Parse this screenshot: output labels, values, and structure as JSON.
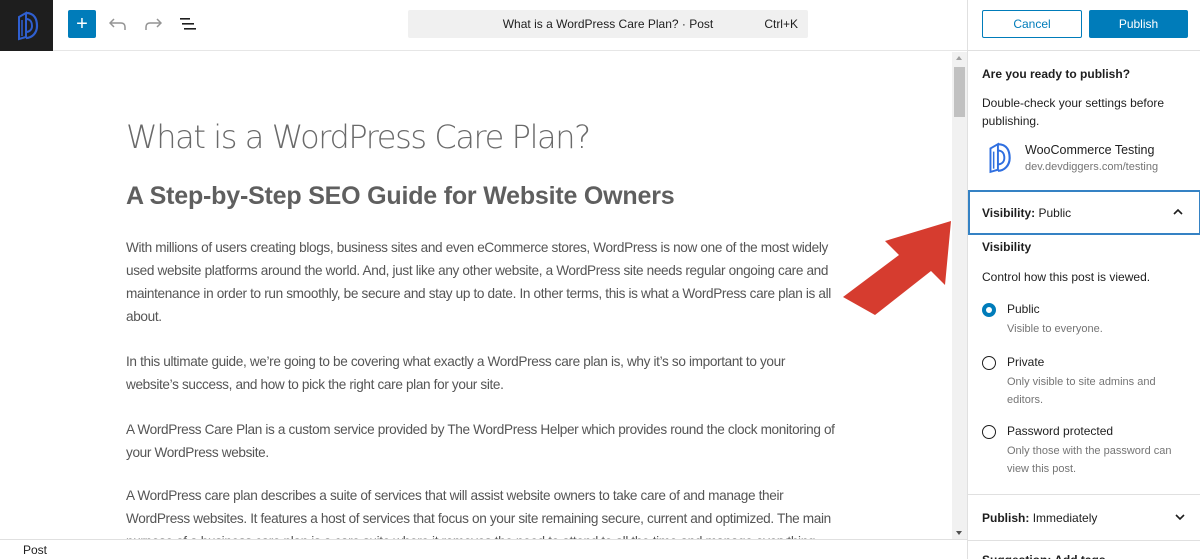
{
  "topbar": {
    "logo_icon": "devdiggers-logo-icon",
    "add_block_label": "+",
    "undo_icon": "undo-icon",
    "redo_icon": "redo-icon",
    "list_view_icon": "list-view-icon",
    "command_bar_text": "What is a WordPress Care Plan? · Post",
    "command_shortcut": "Ctrl+K"
  },
  "editor": {
    "title": "What is a WordPress Care Plan?",
    "heading": "A Step-by-Step SEO Guide for Website Owners",
    "paragraphs": [
      "With millions of users creating blogs, business sites and even eCommerce stores, WordPress is now one of the most widely used website platforms around the world. And, just like any other website, a WordPress site needs regular ongoing care and maintenance in order to run smoothly, be secure and stay up to date. In other terms, this is what a WordPress care plan is all about.",
      "In this ultimate guide, we’re going to be covering what exactly a WordPress care plan is, why it’s so important to your website’s success, and how to pick the right care plan for your site.",
      "A WordPress Care Plan is a custom service provided by The WordPress Helper which provides round the clock monitoring of your WordPress website.",
      "A WordPress care plan describes a suite of services that will assist website owners to take care of and manage their WordPress websites. It features a host of services that focus on your site remaining secure, current and optimized. The main purpose of a business care plan is a care suite where it removes the need to attend to all the time and manage everything"
    ]
  },
  "statusbar": {
    "label": "Post"
  },
  "annotation": {
    "arrow_color": "#d63c2f"
  },
  "sidebar": {
    "cancel_label": "Cancel",
    "publish_label": "Publish",
    "ready_title": "Are you ready to publish?",
    "ready_desc": "Double-check your settings before publishing.",
    "site_name": "WooCommerce Testing",
    "site_url": "dev.devdiggers.com/testing",
    "visibility_header_key": "Visibility:",
    "visibility_header_value": "Public",
    "visibility_title": "Visibility",
    "visibility_desc": "Control how this post is viewed.",
    "visibility_options": [
      {
        "label": "Public",
        "help": "Visible to everyone.",
        "checked": true
      },
      {
        "label": "Private",
        "help": "Only visible to site admins and editors.",
        "checked": false
      },
      {
        "label": "Password protected",
        "help": "Only those with the password can view this post.",
        "checked": false
      }
    ],
    "publish_key": "Publish:",
    "publish_value": "Immediately",
    "next_row_label": "Suggestion: Add tags"
  },
  "colors": {
    "accent": "#007cba",
    "focus_border": "#3582c4",
    "logo_blue": "#2f5fd0",
    "dark_bg": "#1e1e1e"
  }
}
